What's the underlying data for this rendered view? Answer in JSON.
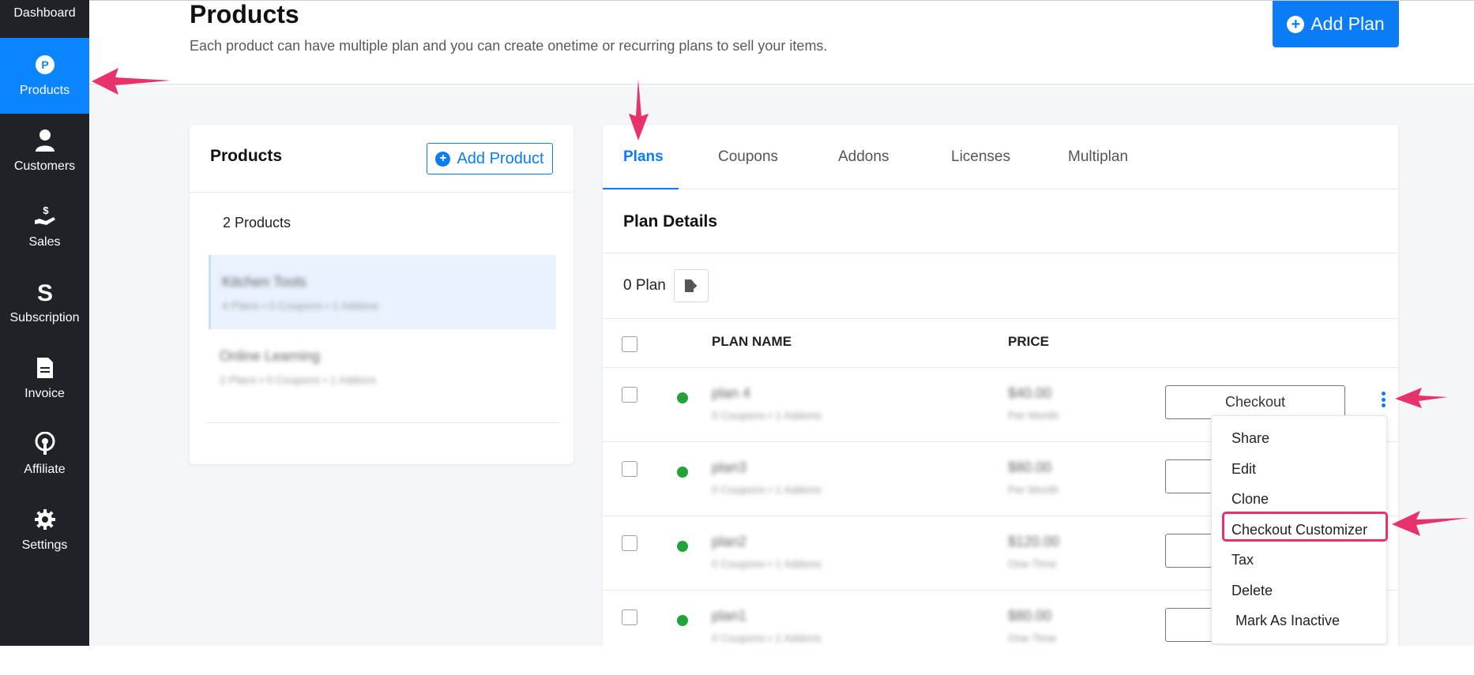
{
  "sidebar": {
    "top_label": "Dashboard",
    "items": [
      {
        "label": "Products",
        "icon": "products-icon",
        "active": true
      },
      {
        "label": "Customers",
        "icon": "customer-icon",
        "active": false
      },
      {
        "label": "Sales",
        "icon": "sales-icon",
        "active": false
      },
      {
        "label": "Subscription",
        "icon": "subscription-icon",
        "active": false
      },
      {
        "label": "Invoice",
        "icon": "invoice-icon",
        "active": false
      },
      {
        "label": "Affiliate",
        "icon": "affiliate-icon",
        "active": false
      },
      {
        "label": "Settings",
        "icon": "gear-icon",
        "active": false
      }
    ]
  },
  "header": {
    "title": "Products",
    "subtitle": "Each product can have multiple plan and you can create onetime or recurring plans to sell your items.",
    "add_plan_label": "Add Plan"
  },
  "products_panel": {
    "title": "Products",
    "add_product_label": "Add Product",
    "count_label": "2 Products",
    "items": [
      {
        "name": "Kitchen Tools",
        "meta": "4 Plans • 0 Coupons • 1 Addons",
        "selected": true
      },
      {
        "name": "Online Learning",
        "meta": "2 Plans • 0 Coupons • 1 Addons",
        "selected": false
      }
    ]
  },
  "plans_panel": {
    "tabs": [
      {
        "label": "Plans",
        "active": true
      },
      {
        "label": "Coupons",
        "active": false
      },
      {
        "label": "Addons",
        "active": false
      },
      {
        "label": "Licenses",
        "active": false
      },
      {
        "label": "Multiplan",
        "active": false
      }
    ],
    "section_title": "Plan Details",
    "plan_count": "0 Plan",
    "columns": {
      "name": "PLAN NAME",
      "price": "PRICE"
    },
    "rows": [
      {
        "name": "plan 4",
        "meta": "0 Coupons • 1 Addons",
        "price": "$40.00",
        "frequency": "Per Month",
        "checkout_label": "Checkout",
        "status_color": "#22a33a"
      },
      {
        "name": "plan3",
        "meta": "0 Coupons • 1 Addons",
        "price": "$80.00",
        "frequency": "Per Month",
        "checkout_label": "Checkout",
        "status_color": "#22a33a"
      },
      {
        "name": "plan2",
        "meta": "0 Coupons • 1 Addons",
        "price": "$120.00",
        "frequency": "One-Time",
        "checkout_label": "Checkout",
        "status_color": "#22a33a"
      },
      {
        "name": "plan1",
        "meta": "0 Coupons • 1 Addons",
        "price": "$80.00",
        "frequency": "One-Time",
        "checkout_label": "Checkout",
        "status_color": "#22a33a"
      }
    ]
  },
  "row_menu": {
    "items": [
      "Share",
      "Edit",
      "Clone",
      "Checkout Customizer",
      "Tax",
      "Delete",
      "Mark As Inactive"
    ],
    "highlighted": "Checkout Customizer"
  },
  "colors": {
    "accent": "#0a7cf5",
    "sidebar_bg": "#1f2328",
    "annotation_arrow": "#e8326b",
    "status_active": "#22a33a"
  }
}
